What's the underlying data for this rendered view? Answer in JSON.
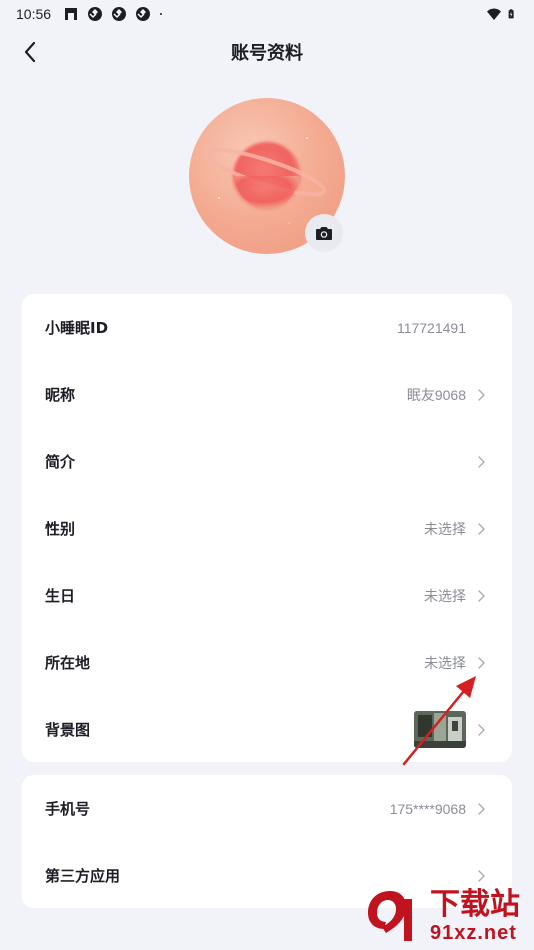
{
  "status_bar": {
    "time": "10:56",
    "left_icons": [
      "wechat-like-icon",
      "aperture-icon",
      "aperture-icon",
      "aperture-icon",
      "dot-icon"
    ],
    "right_icons": [
      "wifi-icon",
      "battery-charging-icon"
    ]
  },
  "header": {
    "title": "账号资料",
    "back_icon": "chevron-left-icon"
  },
  "avatar": {
    "camera_icon": "camera-icon"
  },
  "profile_rows": [
    {
      "label": "小睡眠ID",
      "value": "117721491",
      "chevron": false
    },
    {
      "label": "昵称",
      "value": "眠友9068",
      "chevron": true
    },
    {
      "label": "简介",
      "value": "",
      "chevron": true
    },
    {
      "label": "性别",
      "value": "未选择",
      "chevron": true
    },
    {
      "label": "生日",
      "value": "未选择",
      "chevron": true
    },
    {
      "label": "所在地",
      "value": "未选择",
      "chevron": true
    },
    {
      "label": "背景图",
      "value": "",
      "chevron": true
    }
  ],
  "account_rows": [
    {
      "label": "手机号",
      "value": "175****9068",
      "chevron": true
    },
    {
      "label": "第三方应用",
      "value": "",
      "chevron": true
    }
  ],
  "watermark": {
    "title": "下载站",
    "url": "91xz.net"
  },
  "colors": {
    "background": "#f2f3f8",
    "card": "#ffffff",
    "label": "#1d1d26",
    "value": "#8b8d96",
    "annotation_arrow": "#d42020",
    "watermark": "#c1121f"
  }
}
